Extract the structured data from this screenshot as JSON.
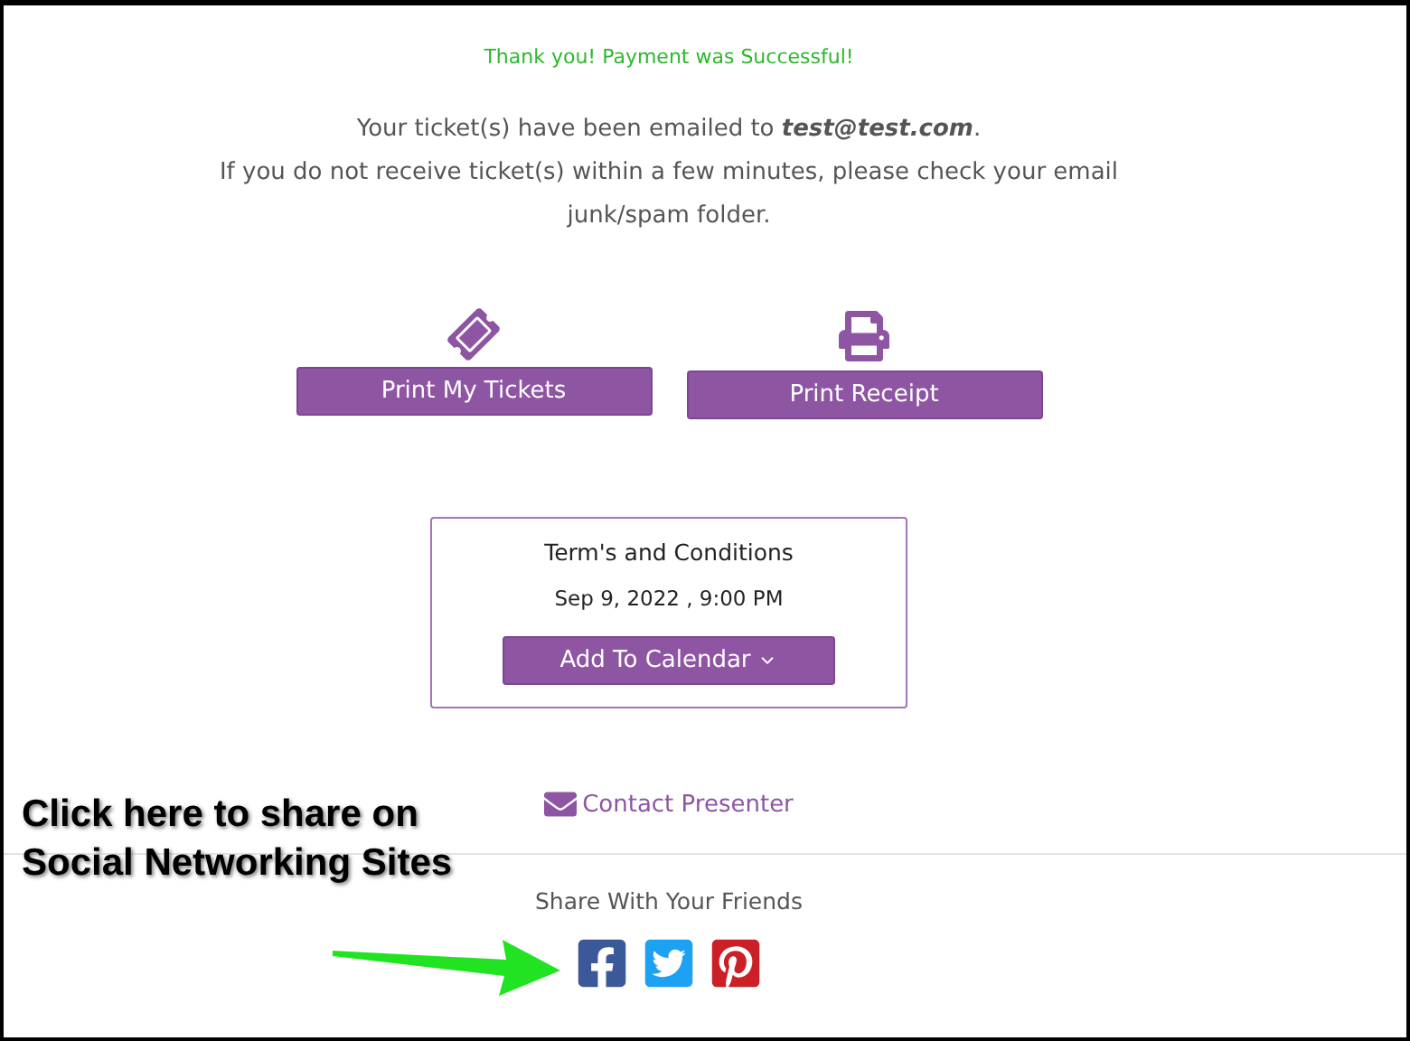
{
  "success_message": "Thank you! Payment was Successful!",
  "email_notice": "Your ticket(s) have been emailed to **test@test.com**.",
  "junk_notice": "If you do not receive ticket(s) within a few minutes, please check your email junk/spam folder.",
  "actions": [
    {
      "kind": "ticket",
      "label": "Print My Tickets"
    },
    {
      "kind": "printer",
      "label": "Print Receipt"
    }
  ],
  "event_card": {
    "title": "Term's and Conditions",
    "date": "Sep 9, 2022 , 9:00 PM",
    "calendar_button": "Add To Calendar"
  },
  "contact_link": "Contact Presenter",
  "share": {
    "title": "Share With Your Friends",
    "networks": [
      {
        "kind": "facebook",
        "color": "#3b5998"
      },
      {
        "kind": "twitter",
        "color": "#1da1f2"
      },
      {
        "kind": "pinterest",
        "color": "#cb2027"
      }
    ]
  },
  "annotation": "Click here to share on Social Networking Sites"
}
